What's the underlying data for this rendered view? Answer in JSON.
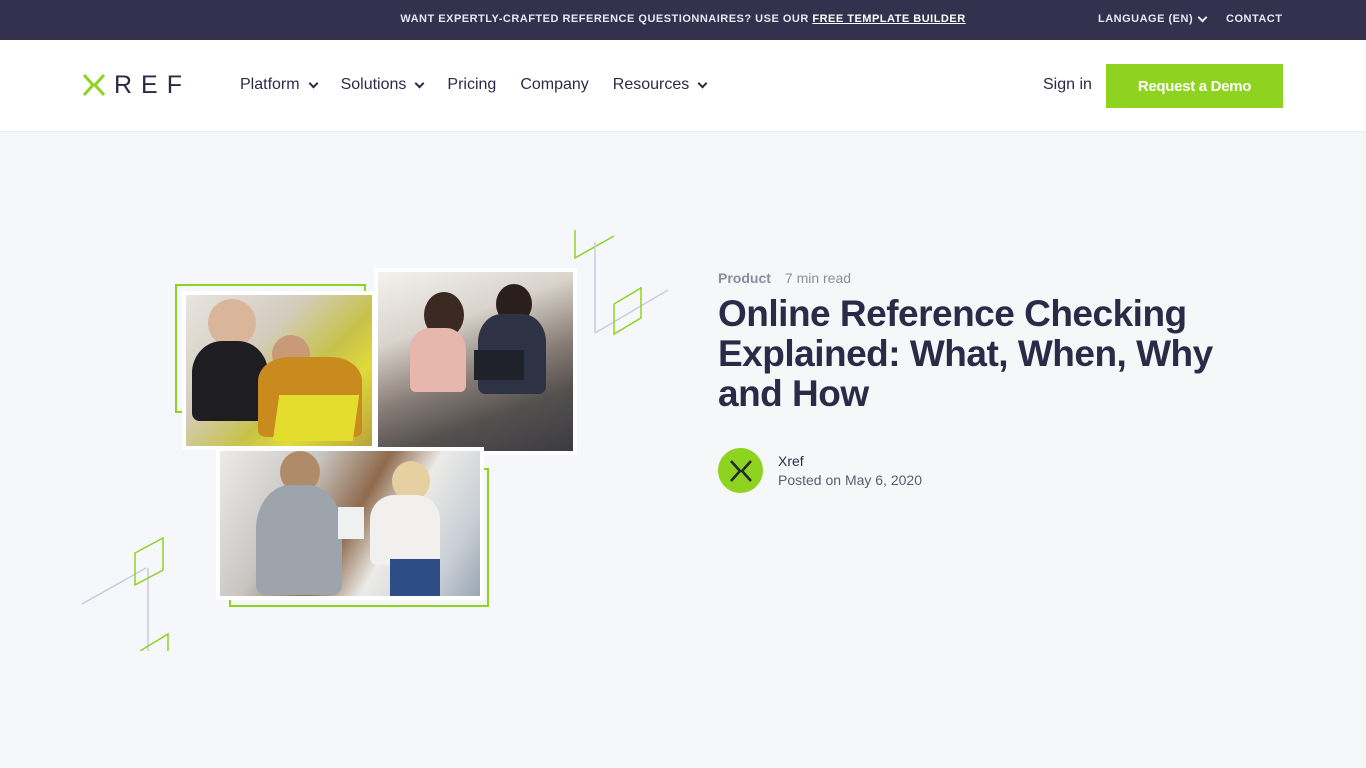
{
  "topbar": {
    "announcement": "WANT EXPERTLY-CRAFTED REFERENCE QUESTIONNAIRES? USE OUR",
    "announcement_link": "FREE TEMPLATE BUILDER",
    "language": "LANGUAGE (EN)",
    "contact": "CONTACT"
  },
  "header": {
    "logo_text": "REF",
    "nav": [
      {
        "label": "Platform",
        "has_dropdown": true
      },
      {
        "label": "Solutions",
        "has_dropdown": true
      },
      {
        "label": "Pricing",
        "has_dropdown": false
      },
      {
        "label": "Company",
        "has_dropdown": false
      },
      {
        "label": "Resources",
        "has_dropdown": true
      }
    ],
    "sign_in": "Sign in",
    "demo_button": "Request a Demo"
  },
  "article": {
    "category": "Product",
    "read_time": "7 min read",
    "title": "Online Reference Checking Explained: What, When, Why and How",
    "author": "Xref",
    "posted": "Posted on May 6, 2020"
  },
  "colors": {
    "brand_green": "#8fd321",
    "navy": "#33314e",
    "text_dark": "#2b2b48",
    "page_bg": "#f6f7f9"
  },
  "icons": {
    "logo": "xref-x-logo-icon",
    "avatar": "xref-x-avatar-icon",
    "dropdown": "chevron-down-icon"
  }
}
